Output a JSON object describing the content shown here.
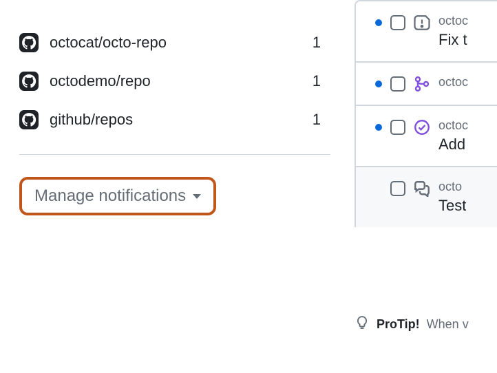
{
  "sidebar": {
    "repos": [
      {
        "name": "octocat/octo-repo",
        "count": "1"
      },
      {
        "name": "octodemo/repo",
        "count": "1"
      },
      {
        "name": "github/repos",
        "count": "1"
      }
    ],
    "manage_label": "Manage notifications"
  },
  "notifications": [
    {
      "repo": "octoc",
      "title": "Fix t",
      "unread": true,
      "type": "issue"
    },
    {
      "repo": "octoc",
      "title": "",
      "unread": true,
      "type": "merge"
    },
    {
      "repo": "octoc",
      "title": "Add",
      "unread": true,
      "type": "check"
    },
    {
      "repo": "octo",
      "title": "Test",
      "unread": false,
      "type": "discussion"
    }
  ],
  "protip": {
    "label": "ProTip!",
    "text": "When v"
  }
}
